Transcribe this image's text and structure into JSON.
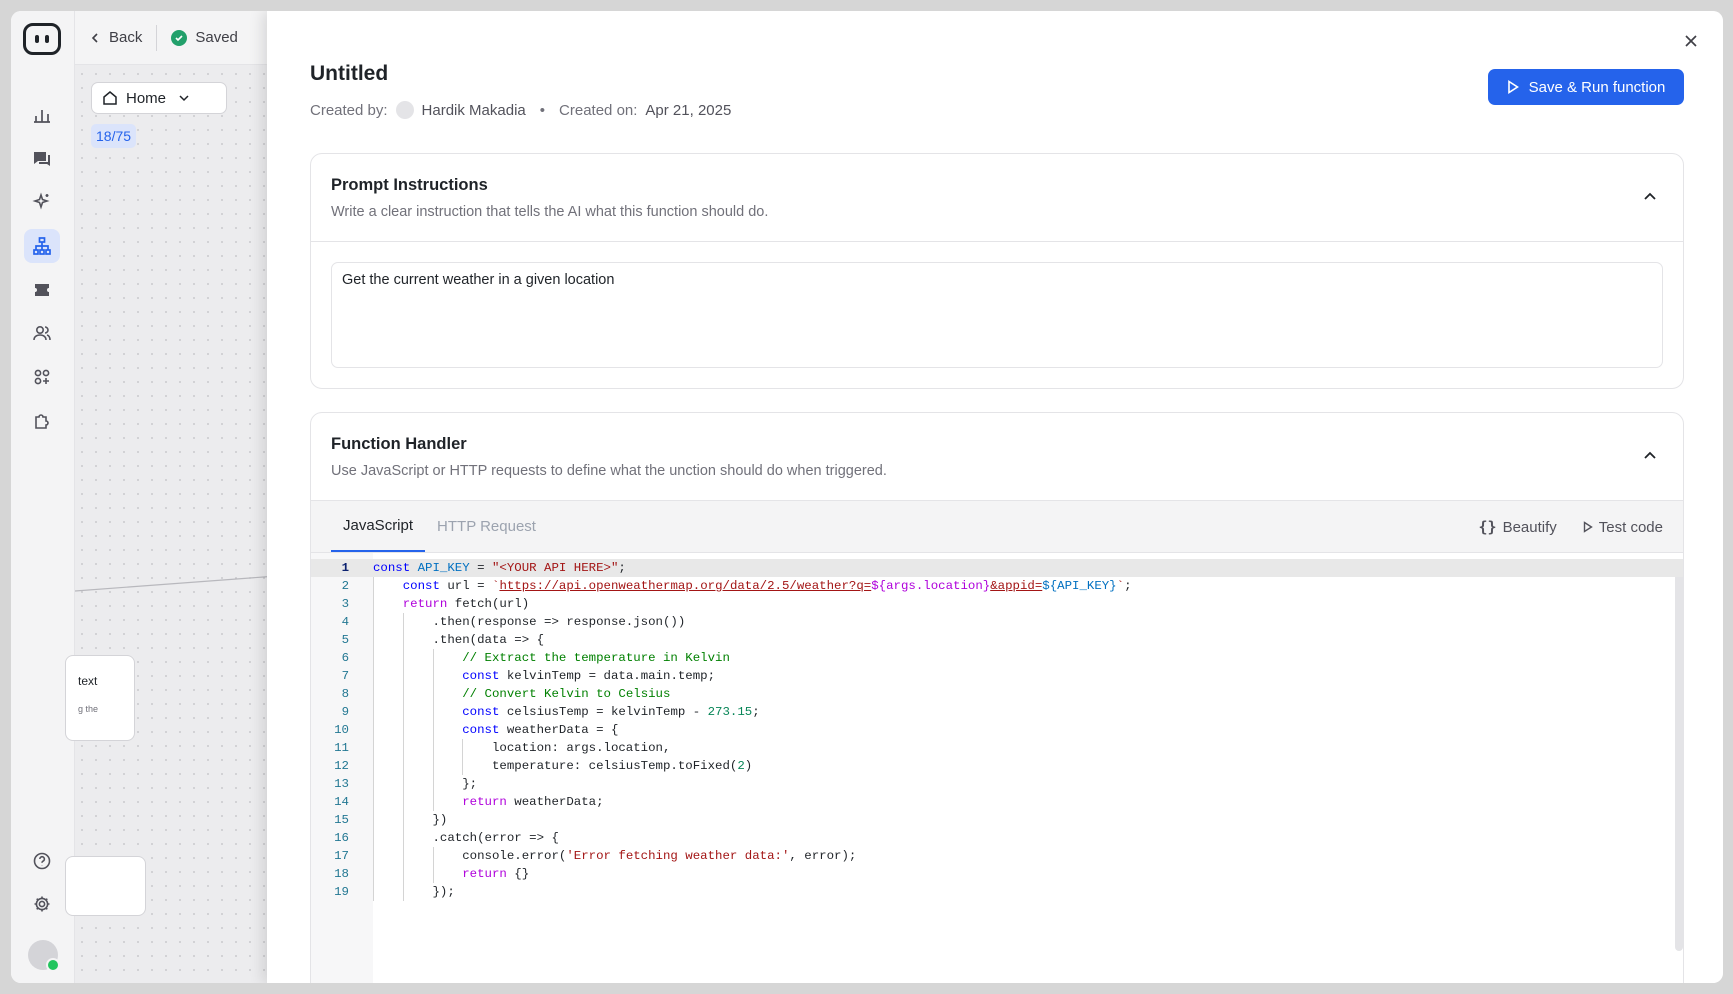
{
  "nav": {
    "back_label": "Back",
    "saved_label": "Saved",
    "home_label": "Home",
    "count_badge": "18/75",
    "rail_icons": [
      "bar-chart-icon",
      "chat-icon",
      "sparkle-icon",
      "workflow-icon",
      "ticket-icon",
      "users-icon",
      "apps-icon",
      "plugin-icon",
      "help-icon",
      "gear-icon"
    ]
  },
  "canvas": {
    "node_label": "text",
    "node_snippet": "g the"
  },
  "header": {
    "title": "Untitled",
    "created_by_label": "Created by:",
    "created_by": "Hardik Makadia",
    "bullet": "•",
    "created_on_label": "Created on:",
    "created_on": "Apr 21, 2025",
    "run_button": "Save & Run function"
  },
  "prompt": {
    "title": "Prompt Instructions",
    "description": "Write a clear instruction that tells the AI what this function should do.",
    "value": "Get the current weather in a given location"
  },
  "handler": {
    "title": "Function Handler",
    "description": "Use JavaScript or HTTP requests to define what the unction should do when triggered.",
    "tabs": [
      "JavaScript",
      "HTTP Request"
    ],
    "beautify_label": "Beautify",
    "test_label": "Test code"
  },
  "code_lines": [
    "const API_KEY = \"<YOUR API HERE>\";",
    "    const url = `https://api.openweathermap.org/data/2.5/weather?q=${args.location}&appid=${API_KEY}`;",
    "    return fetch(url)",
    "        .then(response => response.json())",
    "        .then(data => {",
    "            // Extract the temperature in Kelvin",
    "            const kelvinTemp = data.main.temp;",
    "            // Convert Kelvin to Celsius",
    "            const celsiusTemp = kelvinTemp - 273.15;",
    "            const weatherData = {",
    "                location: args.location,",
    "                temperature: celsiusTemp.toFixed(2)",
    "            };",
    "            return weatherData;",
    "        })",
    "        .catch(error => {",
    "            console.error('Error fetching weather data:', error);",
    "            return {}",
    "        });"
  ],
  "colors": {
    "accent": "#2563eb",
    "saved": "#22a06b"
  }
}
